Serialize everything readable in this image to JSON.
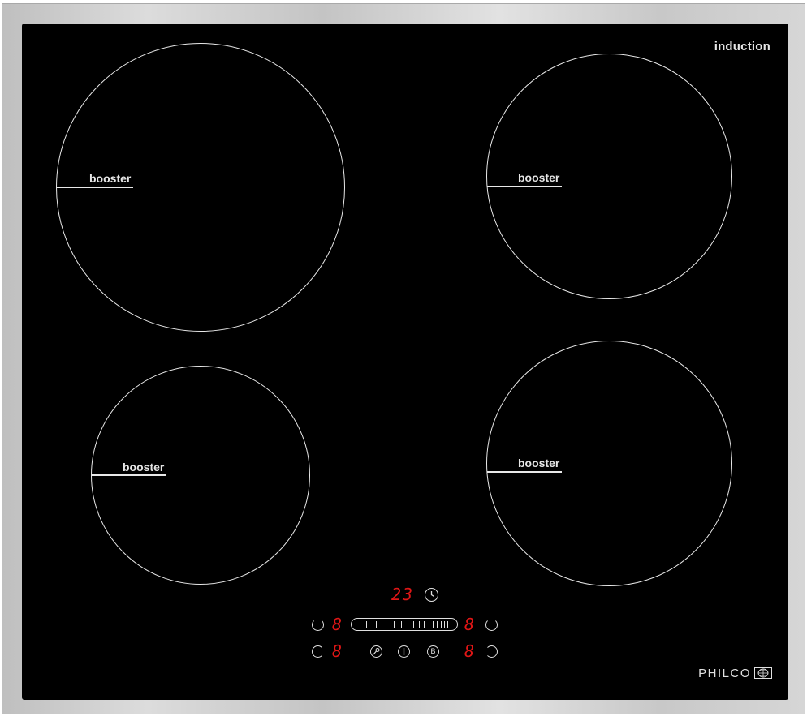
{
  "hob": {
    "brand_text": "induction",
    "logo_text": "PHILCO",
    "frame_color": "#c8c8c8",
    "glass_color": "#000000",
    "line_color": "#e8e8e8",
    "display_color": "#e01616",
    "zones": [
      {
        "id": "rear-left",
        "label": "booster"
      },
      {
        "id": "rear-right",
        "label": "booster"
      },
      {
        "id": "front-left",
        "label": "booster"
      },
      {
        "id": "front-right",
        "label": "booster"
      }
    ]
  },
  "controls": {
    "timer_display": "23",
    "zone_digit_rear_left": "8",
    "zone_digit_rear_right": "8",
    "zone_digit_front_left": "8",
    "zone_digit_front_right": "8",
    "boost_button": "B",
    "icons": [
      "timer-icon",
      "lock-icon",
      "power-icon",
      "booster-icon",
      "zone-select-icon"
    ]
  }
}
